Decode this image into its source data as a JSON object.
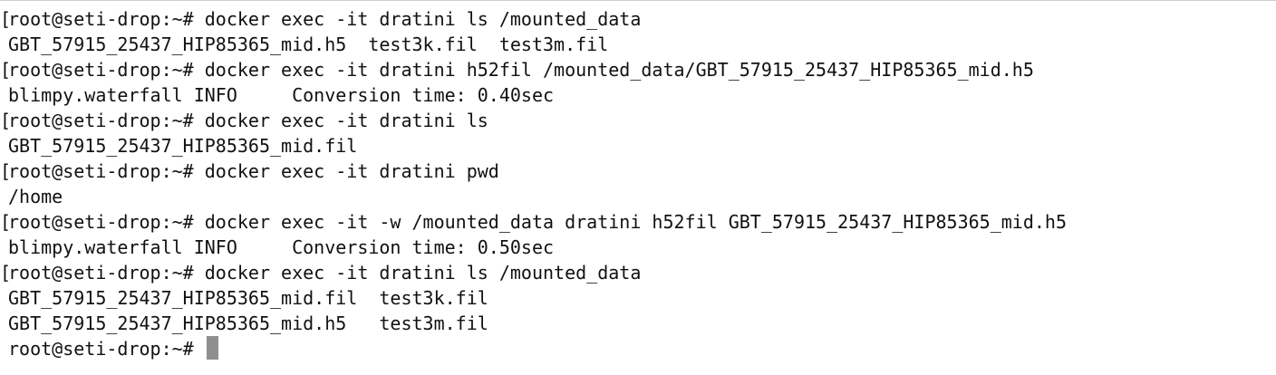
{
  "terminal": {
    "lines": [
      {
        "mark": "[",
        "text": "root@seti-drop:~# docker exec -it dratini ls /mounted_data"
      },
      {
        "mark": "",
        "text": "GBT_57915_25437_HIP85365_mid.h5  test3k.fil  test3m.fil"
      },
      {
        "mark": "[",
        "text": "root@seti-drop:~# docker exec -it dratini h52fil /mounted_data/GBT_57915_25437_HIP85365_mid.h5"
      },
      {
        "mark": "",
        "text": "blimpy.waterfall INFO     Conversion time: 0.40sec"
      },
      {
        "mark": "[",
        "text": "root@seti-drop:~# docker exec -it dratini ls"
      },
      {
        "mark": "",
        "text": "GBT_57915_25437_HIP85365_mid.fil"
      },
      {
        "mark": "[",
        "text": "root@seti-drop:~# docker exec -it dratini pwd"
      },
      {
        "mark": "",
        "text": "/home"
      },
      {
        "mark": "[",
        "text": "root@seti-drop:~# docker exec -it -w /mounted_data dratini h52fil GBT_57915_25437_HIP85365_mid.h5"
      },
      {
        "mark": "",
        "text": "blimpy.waterfall INFO     Conversion time: 0.50sec"
      },
      {
        "mark": "[",
        "text": "root@seti-drop:~# docker exec -it dratini ls /mounted_data"
      },
      {
        "mark": "",
        "text": "GBT_57915_25437_HIP85365_mid.fil  test3k.fil"
      },
      {
        "mark": "",
        "text": "GBT_57915_25437_HIP85365_mid.h5   test3m.fil"
      },
      {
        "mark": "",
        "text": "root@seti-drop:~# "
      }
    ],
    "cursor_color": "#8f8f8f",
    "background_color": "#ffffff",
    "text_color": "#111111"
  }
}
